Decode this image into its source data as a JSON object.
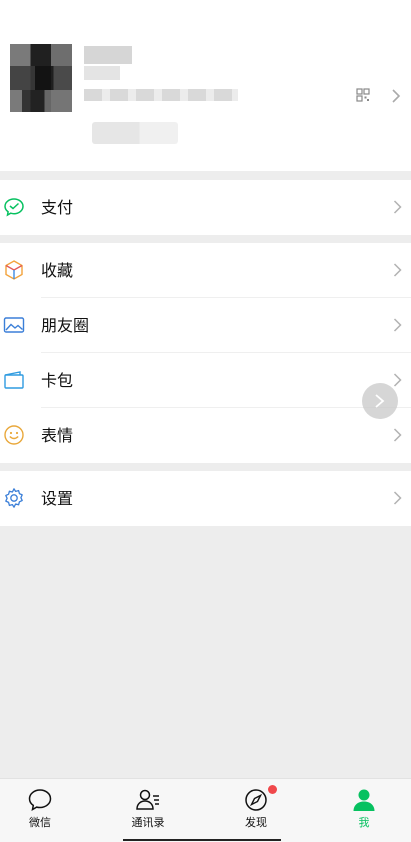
{
  "profile": {
    "nickname": "",
    "wechat_id": "",
    "status": ""
  },
  "menu": {
    "pay": {
      "label": "支付",
      "icon": "wechat-pay-icon"
    },
    "favorites": {
      "label": "收藏",
      "icon": "cube-icon"
    },
    "moments": {
      "label": "朋友圈",
      "icon": "photo-icon"
    },
    "cards": {
      "label": "卡包",
      "icon": "wallet-icon"
    },
    "stickers": {
      "label": "表情",
      "icon": "smile-icon"
    },
    "settings": {
      "label": "设置",
      "icon": "gear-icon"
    }
  },
  "tabs": [
    {
      "label": "微信",
      "icon": "chat-bubble-icon"
    },
    {
      "label": "通讯录",
      "icon": "contacts-icon"
    },
    {
      "label": "发现",
      "icon": "compass-icon"
    },
    {
      "label": "我",
      "icon": "person-icon"
    }
  ],
  "colors": {
    "accent": "#07c160",
    "background": "#ededed",
    "badge": "#f0484b"
  }
}
